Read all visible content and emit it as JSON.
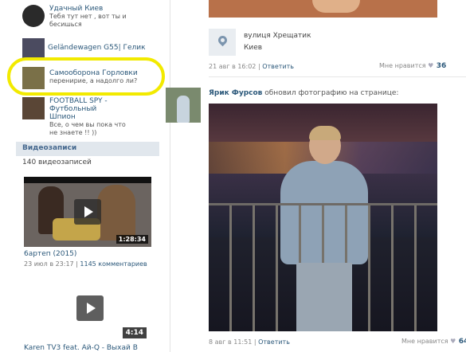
{
  "sidebar": {
    "groups": [
      {
        "title": "Удачный Киев",
        "desc": "Тебя тут нет , вот ты и бесишься"
      },
      {
        "title": "Geländewagen G55| Гелик",
        "desc": ""
      },
      {
        "title": "Самооборона Горловки",
        "desc": "перенирие, а надолго ли?"
      },
      {
        "title": "FOOTBALL SPY - Футбольный Шпион",
        "desc": "Все, о чем вы пока что не знаете !! ))"
      }
    ],
    "videos_header": "Видеозаписи",
    "videos_count": "140 видеозаписей",
    "video1": {
      "duration": "1:28:34",
      "title": "6артеп (2015)",
      "date": "23 июл в 23:17",
      "comments": "1145 комментариев"
    },
    "video2": {
      "duration": "4:14",
      "title": "Karen TV3 feat. Ай-Q - Выхай В"
    }
  },
  "main": {
    "location": {
      "street": "вулиця Хрещатик",
      "city": "Киев"
    },
    "post1": {
      "date": "21 авг в 16:02",
      "reply": "Ответить",
      "likes_label": "Мне нравится",
      "likes": "36"
    },
    "post2": {
      "author": "Ярик Фурсов",
      "action": "обновил фотографию на странице:",
      "date": "8 авг в 11:51",
      "reply": "Ответить",
      "likes_label": "Мне нравится",
      "likes": "64"
    }
  },
  "colors": {
    "link": "#2b587a",
    "highlight": "#f2ea00",
    "header_bg": "#e1e7ed"
  }
}
